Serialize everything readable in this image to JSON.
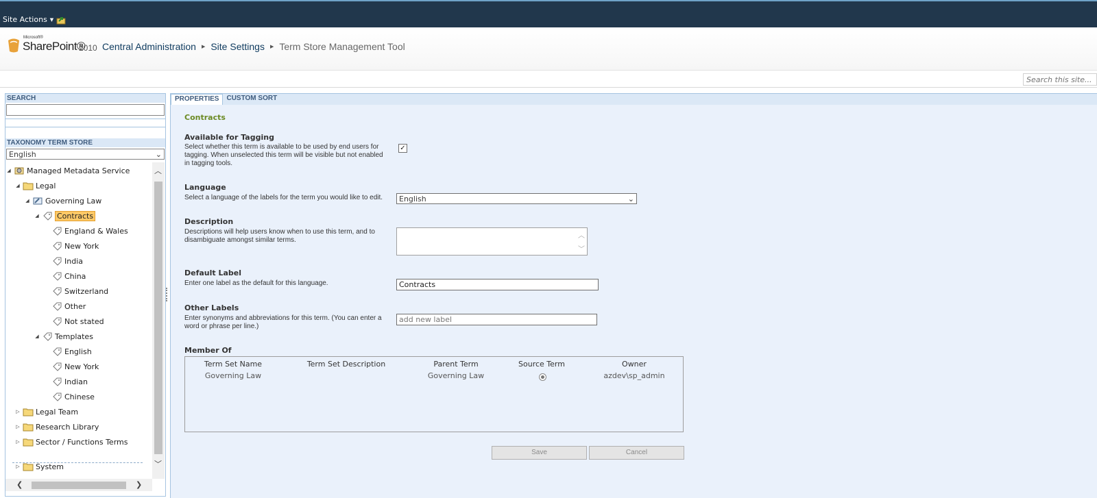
{
  "ribbon": {
    "site_actions": "Site Actions"
  },
  "logo": {
    "microsoft": "Microsoft®",
    "sharepoint": "SharePoint®",
    "year": "2010"
  },
  "breadcrumb": {
    "item1": "Central Administration",
    "item2": "Site Settings",
    "current": "Term Store Management Tool"
  },
  "site_search": {
    "placeholder": "Search this site..."
  },
  "left_panel": {
    "search_header": "SEARCH",
    "store_header": "TAXONOMY TERM STORE",
    "language": "English",
    "tree": {
      "root": "Managed Metadata Service",
      "legal": "Legal",
      "governing_law": "Governing Law",
      "contracts": "Contracts",
      "england_wales": "England & Wales",
      "new_york": "New York",
      "india": "India",
      "china": "China",
      "switzerland": "Switzerland",
      "other": "Other",
      "not_stated": "Not stated",
      "templates": "Templates",
      "english": "English",
      "new_york2": "New York",
      "indian": "Indian",
      "chinese": "Chinese",
      "legal_team": "Legal Team",
      "research_library": "Research Library",
      "sector_functions": "Sector / Functions Terms",
      "system": "System"
    }
  },
  "tabs": {
    "properties": "PROPERTIES",
    "custom_sort": "CUSTOM SORT"
  },
  "properties": {
    "term_name": "Contracts",
    "available": {
      "title": "Available for Tagging",
      "desc": "Select whether this term is available to be used by end users for tagging. When unselected this term will be visible but not enabled in tagging tools.",
      "checked": "✓"
    },
    "language": {
      "title": "Language",
      "desc": "Select a language of the labels for the term you would like to edit.",
      "value": "English"
    },
    "description": {
      "title": "Description",
      "desc": "Descriptions will help users know when to use this term, and to disambiguate amongst similar terms."
    },
    "default_label": {
      "title": "Default Label",
      "desc": "Enter one label as the default for this language.",
      "value": "Contracts"
    },
    "other_labels": {
      "title": "Other Labels",
      "desc": "Enter synonyms and abbreviations for this term. (You can enter a word or phrase per line.)",
      "placeholder": "add new label"
    },
    "member_of": {
      "title": "Member Of",
      "headers": [
        "Term Set Name",
        "Term Set Description",
        "Parent Term",
        "Source Term",
        "Owner"
      ],
      "row": {
        "term_set_name": "Governing Law",
        "term_set_description": "",
        "parent_term": "Governing Law",
        "owner": "azdev\\sp_admin"
      }
    },
    "save_label": "Save",
    "cancel_label": "Cancel"
  }
}
